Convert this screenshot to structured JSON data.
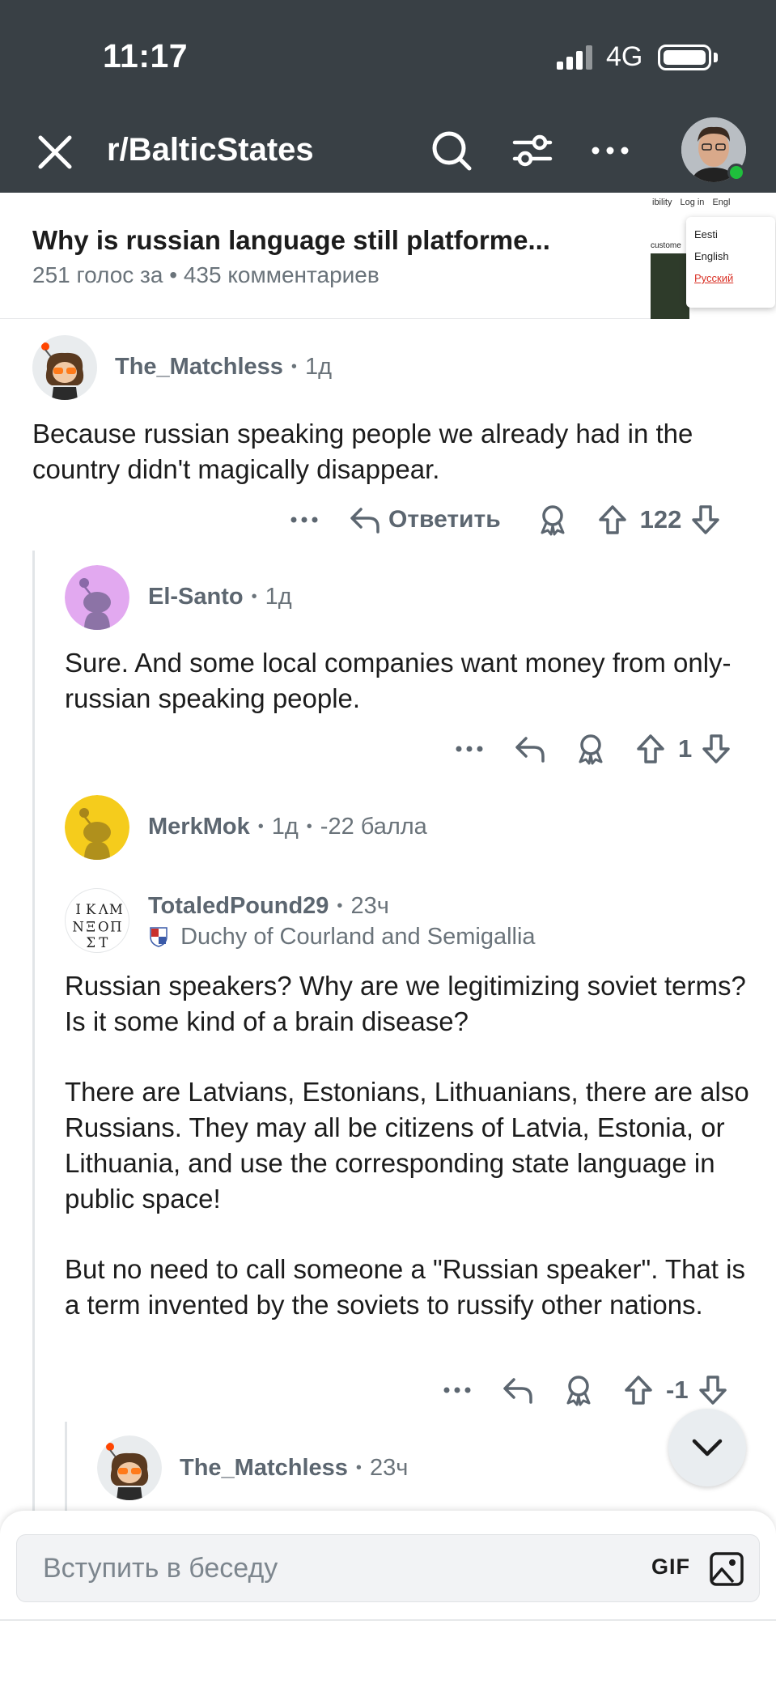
{
  "status_bar": {
    "time": "11:17",
    "network": "4G"
  },
  "header": {
    "subreddit": "r/BalticStates"
  },
  "post": {
    "title": "Why is russian language still platforme...",
    "votes": "251 голос за",
    "comments": "435 комментариев",
    "thumbnail": {
      "bar_items": [
        "ibility",
        "Log in",
        "Engl"
      ],
      "left_text": "custome",
      "menu": [
        "Eesti",
        "English",
        "Русский"
      ]
    }
  },
  "comments": [
    {
      "author": "The_Matchless",
      "age": "1д",
      "avatar": "snoo-glasses-avatar",
      "body": [
        "Because russian speaking people we already had in the country didn't magically disappear."
      ],
      "reply_label": "Ответить",
      "score": "122"
    },
    {
      "author": "El-Santo",
      "age": "1д",
      "avatar": "default-snoo-purple",
      "body": [
        "Sure. And some local companies want money from only-russian speaking people."
      ],
      "score": "1"
    },
    {
      "author": "MerkMok",
      "age": "1д",
      "points": "-22 балла",
      "avatar": "default-snoo-yellow"
    },
    {
      "author": "TotaledPound29",
      "age": "23ч",
      "flair": "Duchy of Courland and Semigallia",
      "avatar": "greek-letters-avatar",
      "avatar_letters": [
        "Ι",
        "Κ",
        "Λ",
        "Μ",
        "Ν",
        "Ξ",
        "Ο",
        "Π",
        "Σ",
        "Τ"
      ],
      "body": [
        "Russian speakers? Why are we legitimizing soviet terms? Is it some kind of a brain disease?",
        "There are Latvians, Estonians, Lithuanians, there are also Russians. They may all be citizens of Latvia, Estonia, or Lithuania, and use the corresponding state language in public space!",
        "But no need to call someone a \"Russian speaker\". That is a term invented by the soviets to russify other nations."
      ],
      "score": "-1"
    },
    {
      "author": "The_Matchless",
      "age": "23ч",
      "avatar": "snoo-glasses-avatar"
    }
  ],
  "composer": {
    "placeholder": "Вступить в беседу",
    "gif_label": "GIF"
  },
  "colors": {
    "topbar": "#394045",
    "online": "#1fbf3c",
    "meta": "#6a737a",
    "thread_line": "#e2e5e8"
  }
}
